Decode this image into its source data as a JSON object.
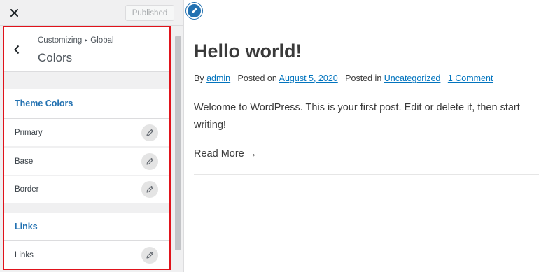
{
  "topbar": {
    "close_icon": "close-icon",
    "published_label": "Published"
  },
  "panel": {
    "breadcrumb_prefix": "Customizing",
    "breadcrumb_separator": "▸",
    "breadcrumb_section": "Global",
    "title": "Colors",
    "back_icon": "chevron-left-icon"
  },
  "sections": {
    "theme_colors": {
      "label": "Theme Colors",
      "items": [
        "Primary",
        "Base",
        "Border"
      ]
    },
    "links": {
      "label": "Links",
      "items": [
        "Links"
      ]
    }
  },
  "preview": {
    "edit_icon": "pencil-icon",
    "post_title": "Hello world!",
    "meta": {
      "by_label": "By",
      "author": "admin",
      "posted_on_label": "Posted on",
      "date": "August 5, 2020",
      "posted_in_label": "Posted in",
      "category": "Uncategorized",
      "comments": "1 Comment"
    },
    "excerpt": "Welcome to WordPress. This is your first post. Edit or delete it, then start writing!",
    "read_more": "Read More",
    "read_more_arrow": "→"
  },
  "colors": {
    "accent": "#2271b1",
    "link": "#0274be",
    "highlight_border": "#e0131b"
  }
}
